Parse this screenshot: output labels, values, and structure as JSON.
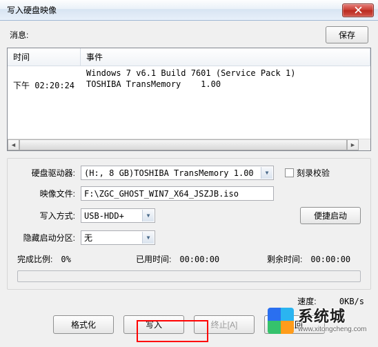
{
  "window": {
    "title": "写入硬盘映像"
  },
  "topRow": {
    "messageLabel": "消息:",
    "saveButton": "保存"
  },
  "log": {
    "columns": {
      "time": "时间",
      "event": "事件"
    },
    "rows": [
      {
        "time": "",
        "event": "Windows 7 v6.1 Build 7601 (Service Pack 1)"
      },
      {
        "time": "下午 02:20:24",
        "event": "TOSHIBA TransMemory    1.00"
      }
    ]
  },
  "form": {
    "driveLabel": "硬盘驱动器:",
    "driveValue": "(H:, 8 GB)TOSHIBA TransMemory    1.00",
    "verifyLabel": "刻录校验",
    "imageLabel": "映像文件:",
    "imageValue": "F:\\ZGC_GHOST_WIN7_X64_JSZJB.iso",
    "writeModeLabel": "写入方式:",
    "writeModeValue": "USB-HDD+",
    "quickBootButton": "便捷启动",
    "hiddenPartLabel": "隐藏启动分区:",
    "hiddenPartValue": "无"
  },
  "progress": {
    "completeLabel": "完成比例:",
    "completeValue": "0%",
    "elapsedLabel": "已用时间:",
    "elapsedValue": "00:00:00",
    "remainLabel": "剩余时间:",
    "remainValue": "00:00:00"
  },
  "speed": {
    "label": "速度:",
    "value": "0KB/s"
  },
  "buttons": {
    "format": "格式化",
    "write": "写入",
    "abort": "终止[A]",
    "back": "返回"
  },
  "watermark": {
    "brand": "系统城",
    "url": "www.xitongcheng.com"
  }
}
